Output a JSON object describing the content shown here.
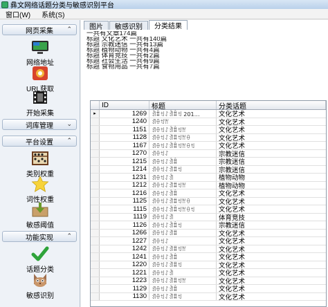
{
  "window": {
    "title": "彝文网络话题分类与敏感识别平台"
  },
  "menu": [
    {
      "label": "窗口(W)"
    },
    {
      "label": "系统(S)"
    }
  ],
  "sidebar": {
    "sections": [
      {
        "title": "网页采集",
        "chevron": "^"
      },
      {
        "title": "词库管理",
        "chevron": "v"
      },
      {
        "title": "平台设置",
        "chevron": "^"
      },
      {
        "title": "功能实现",
        "chevron": "^"
      }
    ],
    "tools": [
      {
        "label": "网络地址",
        "icon": "monitor-icon"
      },
      {
        "label": "URL获取",
        "icon": "url-fetch-icon"
      },
      {
        "label": "开始采集",
        "icon": "film-icon"
      },
      {
        "label": "类别权重",
        "icon": "abacus-icon"
      },
      {
        "label": "词性权重",
        "icon": "star-icon"
      },
      {
        "label": "敏感阈值",
        "icon": "download-box-icon"
      },
      {
        "label": "话题分类",
        "icon": "checkmark-icon"
      },
      {
        "label": "敏感识别",
        "icon": "cat-icon"
      }
    ]
  },
  "tabs": [
    {
      "label": "图片"
    },
    {
      "label": "敏感识别"
    },
    {
      "label": "分类结果"
    }
  ],
  "summary": [
    "一共有文章174篇",
    "标题 文化艺术 一共有140篇",
    "标题 宗教迷信 一共有13篇",
    "标题 植物动物 一共有4篇",
    "标题 体育竞技 一共有2篇",
    "标题 社会生活 一共有9篇",
    "标题 食物用品 一共有7篇"
  ],
  "grid": {
    "columns": [
      "",
      "ID",
      "标题",
      "分类话题"
    ],
    "rows": [
      {
        "marker": "▸",
        "id": "1269",
        "title": "ꀉꐙꉬꋍꀉꐙꉬ 201…",
        "topic": "文化艺术"
      },
      {
        "marker": "",
        "id": "1240",
        "title": "ꀊꂷꉬꀕ",
        "topic": "文化艺术"
      },
      {
        "marker": "",
        "id": "1151",
        "title": "ꀊꂷꉬꋍꀉꐙꉬꀕ",
        "topic": "文化艺术"
      },
      {
        "marker": "",
        "id": "1128",
        "title": "ꀊꂷꉬꋍꀉꐙꉬꀕꂷ",
        "topic": "文化艺术"
      },
      {
        "marker": "",
        "id": "1167",
        "title": "ꀊꂷꉬꋍꀉꐙꉬꀕꂷꉬ",
        "topic": "文化艺术"
      },
      {
        "marker": "",
        "id": "1270",
        "title": "ꀊꂷꉬꋍ",
        "topic": "宗教迷信"
      },
      {
        "marker": "",
        "id": "1215",
        "title": "ꀊꂷꉬꋍꀉꐙ",
        "topic": "宗教迷信"
      },
      {
        "marker": "",
        "id": "1214",
        "title": "ꀊꂷꉬꋍꀉꐙꉬ",
        "topic": "宗教迷信"
      },
      {
        "marker": "",
        "id": "1231",
        "title": "ꀊꂷꉬꋍꀉ",
        "topic": "植物动物"
      },
      {
        "marker": "",
        "id": "1212",
        "title": "ꀊꂷꉬꋍꀉꐙꉬꀕ",
        "topic": "植物动物"
      },
      {
        "marker": "",
        "id": "1216",
        "title": "ꀊꂷꉬꋍꀉꐙ",
        "topic": "文化艺术"
      },
      {
        "marker": "",
        "id": "1125",
        "title": "ꀊꂷꉬꋍꀉꐙꉬꀕꂷ",
        "topic": "文化艺术"
      },
      {
        "marker": "",
        "id": "1115",
        "title": "ꀊꂷꉬꋍꀉꐙꉬꀕꂷꉬ",
        "topic": "文化艺术"
      },
      {
        "marker": "",
        "id": "1119",
        "title": "ꀊꂷꉬꋍꀉ",
        "topic": "体育竞技"
      },
      {
        "marker": "",
        "id": "1126",
        "title": "ꀊꂷꉬꋍꀉꐙꉬ",
        "topic": "宗教迷信"
      },
      {
        "marker": "",
        "id": "1266",
        "title": "ꀊꂷꉬꋍꀉꐙ",
        "topic": "文化艺术"
      },
      {
        "marker": "",
        "id": "1227",
        "title": "ꀊꂷꉬꋍ",
        "topic": "文化艺术"
      },
      {
        "marker": "",
        "id": "1242",
        "title": "ꀊꂷꉬꋍꀉꐙꉬꀕ",
        "topic": "文化艺术"
      },
      {
        "marker": "",
        "id": "1241",
        "title": "ꀊꂷꉬꋍꀉꐙ",
        "topic": "文化艺术"
      },
      {
        "marker": "",
        "id": "1220",
        "title": "ꀊꂷꉬꋍꀉꐙꉬ",
        "topic": "文化艺术"
      },
      {
        "marker": "",
        "id": "1221",
        "title": "ꀊꂷꉬꋍꀉ",
        "topic": "文化艺术"
      },
      {
        "marker": "",
        "id": "1223",
        "title": "ꀊꂷꉬꋍꀉꐙꉬꀕ",
        "topic": "文化艺术"
      },
      {
        "marker": "",
        "id": "1129",
        "title": "ꀊꂷꉬꋍꀉꐙ",
        "topic": "文化艺术"
      },
      {
        "marker": "",
        "id": "1130",
        "title": "ꀊꂷꉬꋍꀉꐙꉬ",
        "topic": "文化艺术"
      }
    ]
  }
}
